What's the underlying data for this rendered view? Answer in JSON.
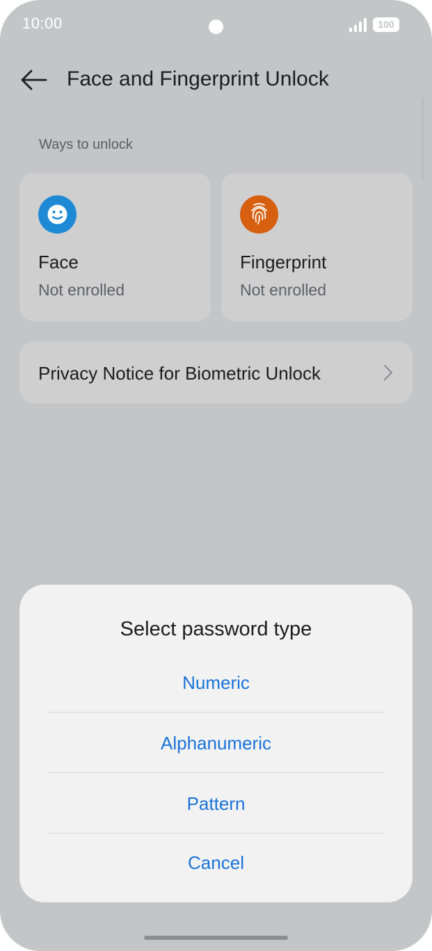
{
  "status_bar": {
    "time": "10:00",
    "battery": "100"
  },
  "header": {
    "title": "Face and Fingerprint Unlock"
  },
  "section": {
    "label": "Ways to unlock"
  },
  "cards": [
    {
      "name": "Face",
      "status": "Not enrolled",
      "icon": "face-unlock-icon",
      "color": "#1e8ad6"
    },
    {
      "name": "Fingerprint",
      "status": "Not enrolled",
      "icon": "fingerprint-icon",
      "color": "#d65f10"
    }
  ],
  "privacy": {
    "label": "Privacy Notice for Biometric Unlock"
  },
  "dialog": {
    "title": "Select password type",
    "options": [
      "Numeric",
      "Alphanumeric",
      "Pattern"
    ],
    "cancel": "Cancel",
    "accent_color": "#1a73d9"
  }
}
